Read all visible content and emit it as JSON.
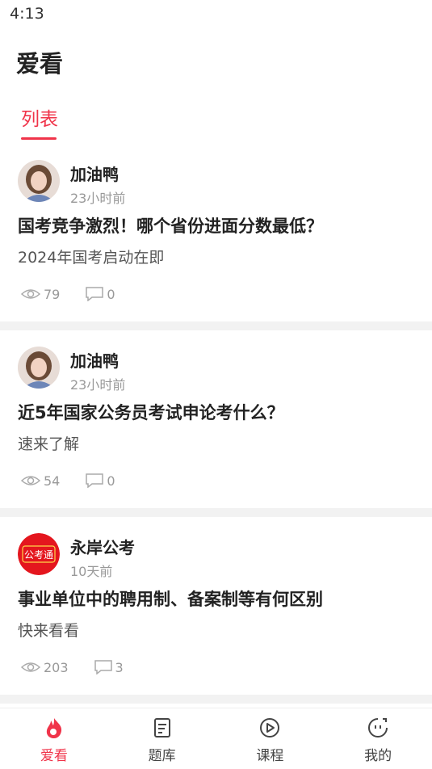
{
  "status": {
    "time": "4:13"
  },
  "app_title": "爱看",
  "tabs": [
    {
      "label": "列表",
      "active": true
    }
  ],
  "posts": [
    {
      "author": "加油鸭",
      "time_ago": "23小时前",
      "title": "国考竞争激烈！哪个省份进面分数最低？",
      "subtitle": "2024年国考启动在即",
      "views": "79",
      "comments": "0",
      "avatar": "person-photo"
    },
    {
      "author": "加油鸭",
      "time_ago": "23小时前",
      "title": "近5年国家公务员考试申论考什么？",
      "subtitle": "速来了解",
      "views": "54",
      "comments": "0",
      "avatar": "person-photo"
    },
    {
      "author": "永岸公考",
      "time_ago": "10天前",
      "title": "事业单位中的聘用制、备案制等有何区别",
      "subtitle": "快来看看",
      "views": "203",
      "comments": "3",
      "avatar": "logo",
      "avatar_text": "公考通"
    }
  ],
  "bottom_nav": [
    {
      "label": "爱看",
      "icon": "fire-icon",
      "active": true
    },
    {
      "label": "题库",
      "icon": "question-bank-icon",
      "active": false
    },
    {
      "label": "课程",
      "icon": "play-circle-icon",
      "active": false
    },
    {
      "label": "我的",
      "icon": "profile-face-icon",
      "active": false
    }
  ],
  "colors": {
    "accent": "#f0344a",
    "muted": "#999999",
    "separator": "#f2f2f2"
  }
}
